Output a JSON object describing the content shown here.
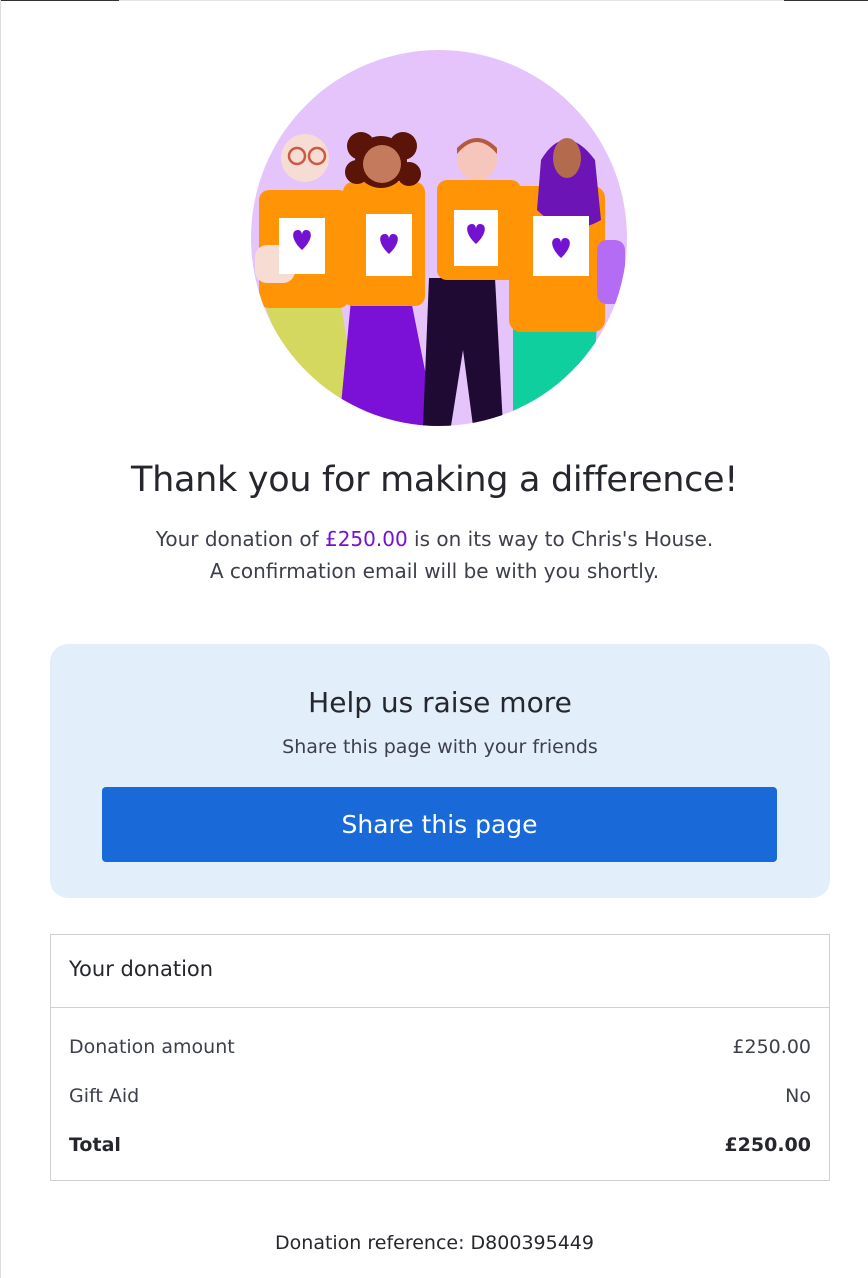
{
  "confirmation": {
    "headline": "Thank you for making a difference!",
    "message_prefix": "Your donation of ",
    "amount": "£250.00",
    "message_suffix": " is on its way to Chris's House.",
    "message_line2": "A confirmation email will be with you shortly."
  },
  "share": {
    "title": "Help us raise more",
    "subtitle": "Share this page with your friends",
    "button_label": "Share this page"
  },
  "summary": {
    "heading": "Your donation",
    "rows": [
      {
        "label": "Donation amount",
        "value": "£250.00"
      },
      {
        "label": "Gift Aid",
        "value": "No"
      },
      {
        "label": "Total",
        "value": "£250.00"
      }
    ]
  },
  "reference": "Donation reference: D800395449",
  "colors": {
    "accent_purple": "#7312d1",
    "button_blue": "#1a69d9",
    "card_background": "#e3eefb",
    "hero_background": "#e4c4fb"
  }
}
